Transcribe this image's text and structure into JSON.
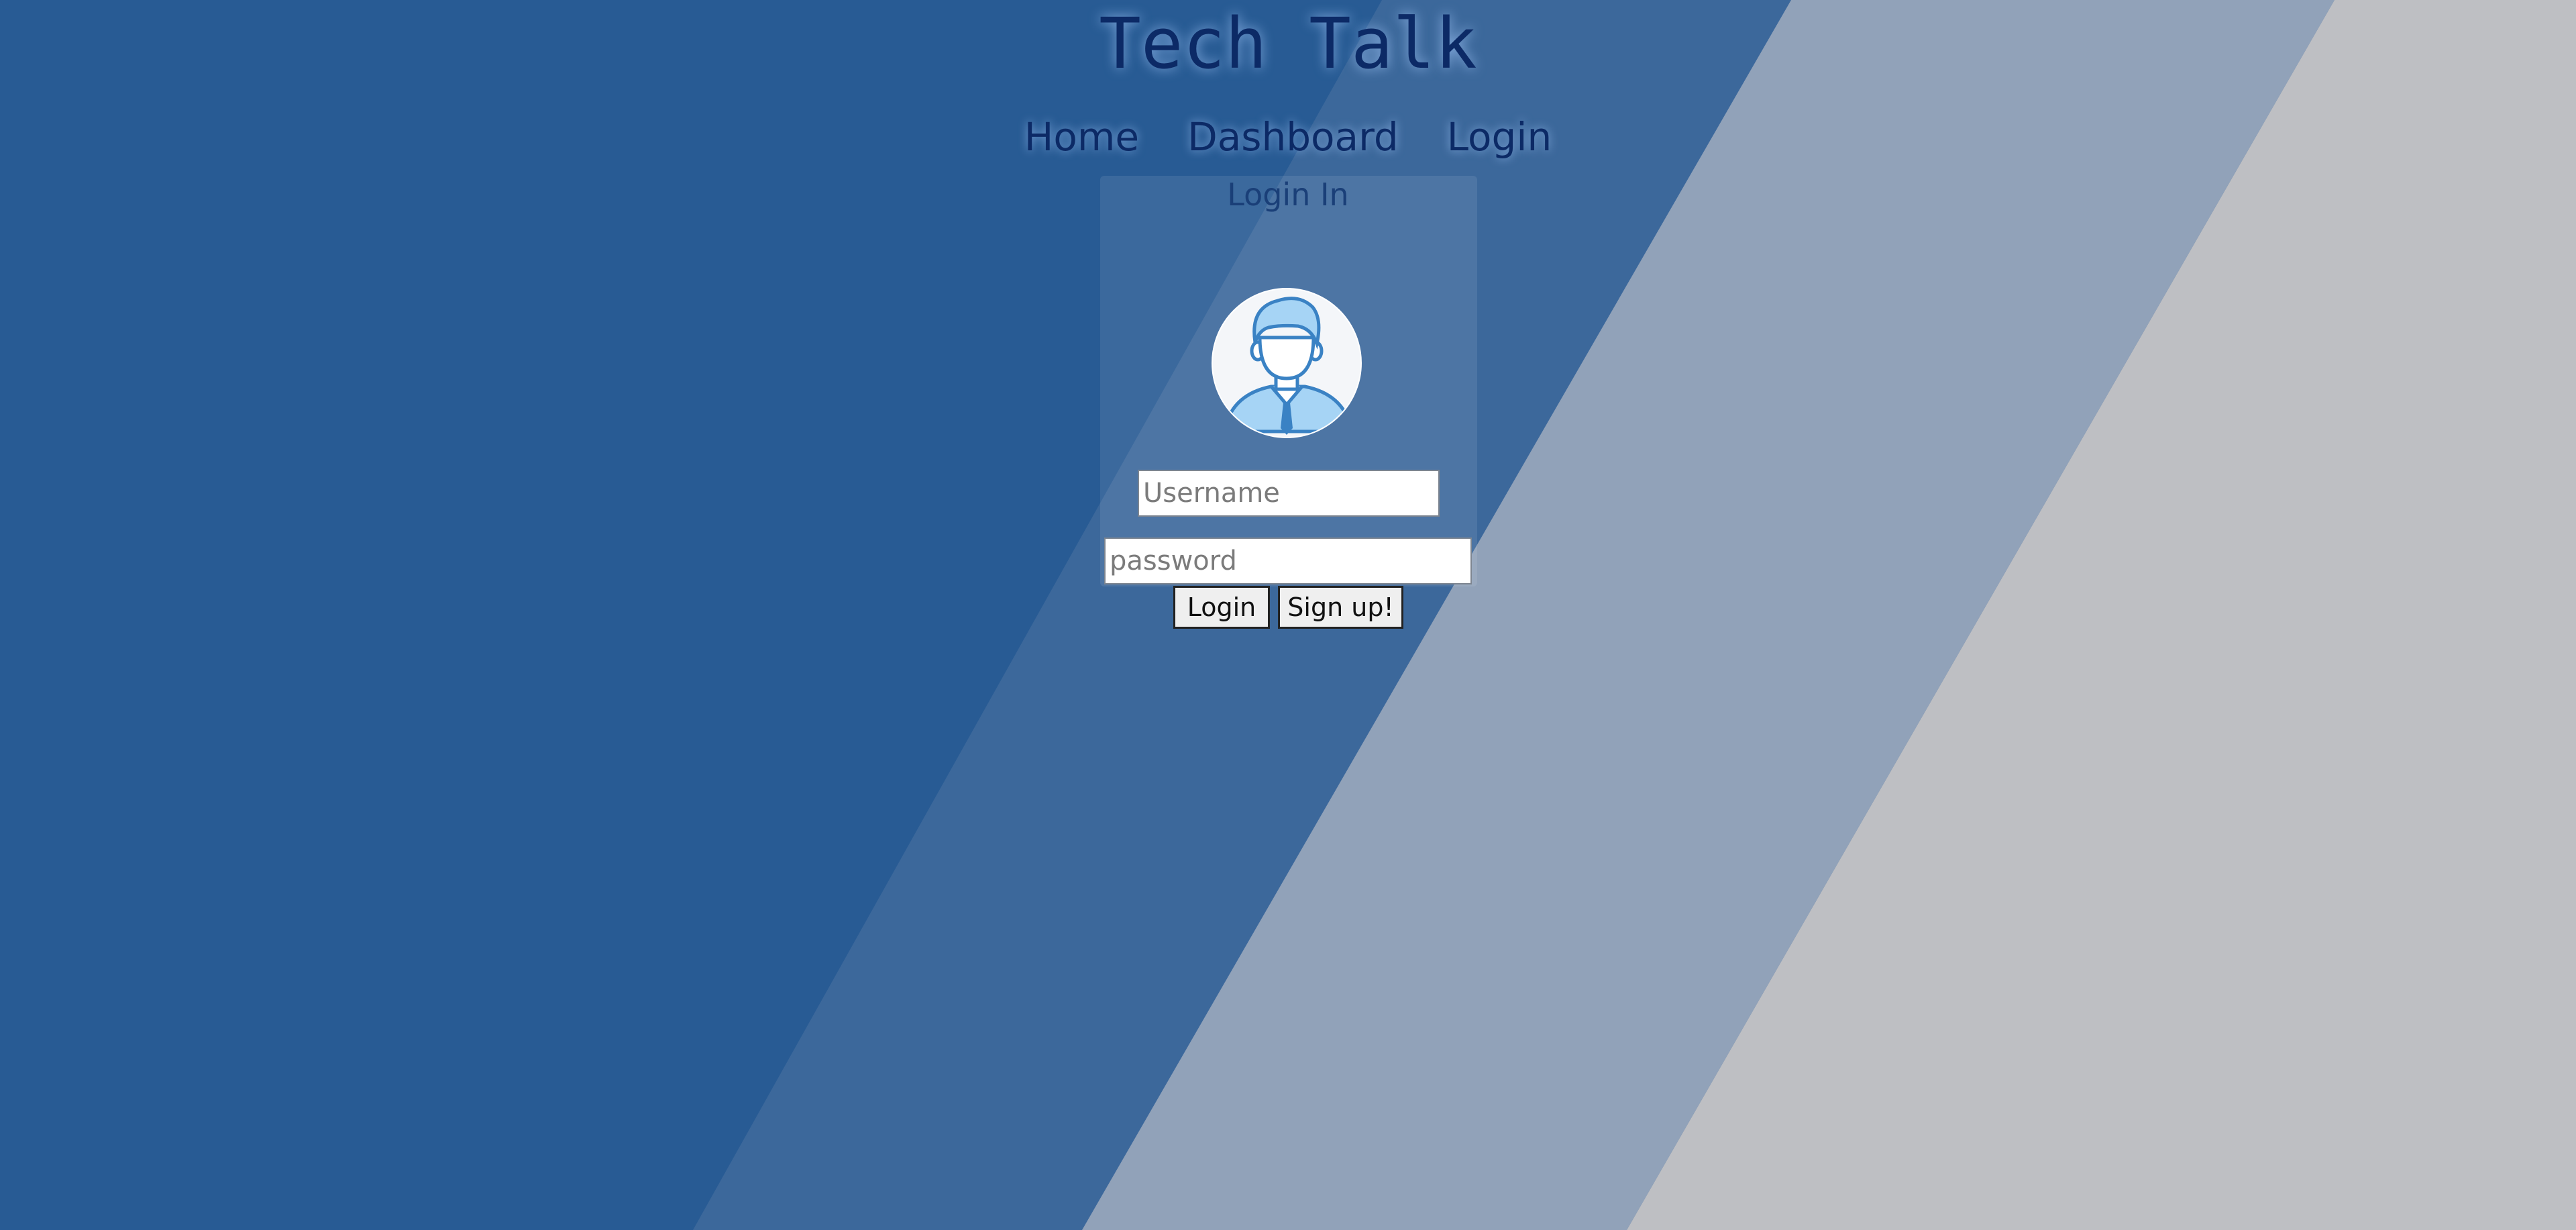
{
  "site": {
    "title": "Tech Talk"
  },
  "nav": {
    "items": [
      {
        "label": "Home"
      },
      {
        "label": "Dashboard"
      },
      {
        "label": "Login"
      }
    ]
  },
  "login_form": {
    "heading": "Login In",
    "avatar_icon": "user-avatar-icon",
    "username": {
      "value": "",
      "placeholder": "Username"
    },
    "password": {
      "value": "",
      "placeholder": "password"
    },
    "login_button": "Login",
    "signup_button": "Sign up!"
  },
  "colors": {
    "background": "#285b94",
    "stripe_light_blue": "#3c689b",
    "stripe_slate": "#91a2b9",
    "stripe_gray": "#bebfc3",
    "title_text": "#0c2a66"
  }
}
